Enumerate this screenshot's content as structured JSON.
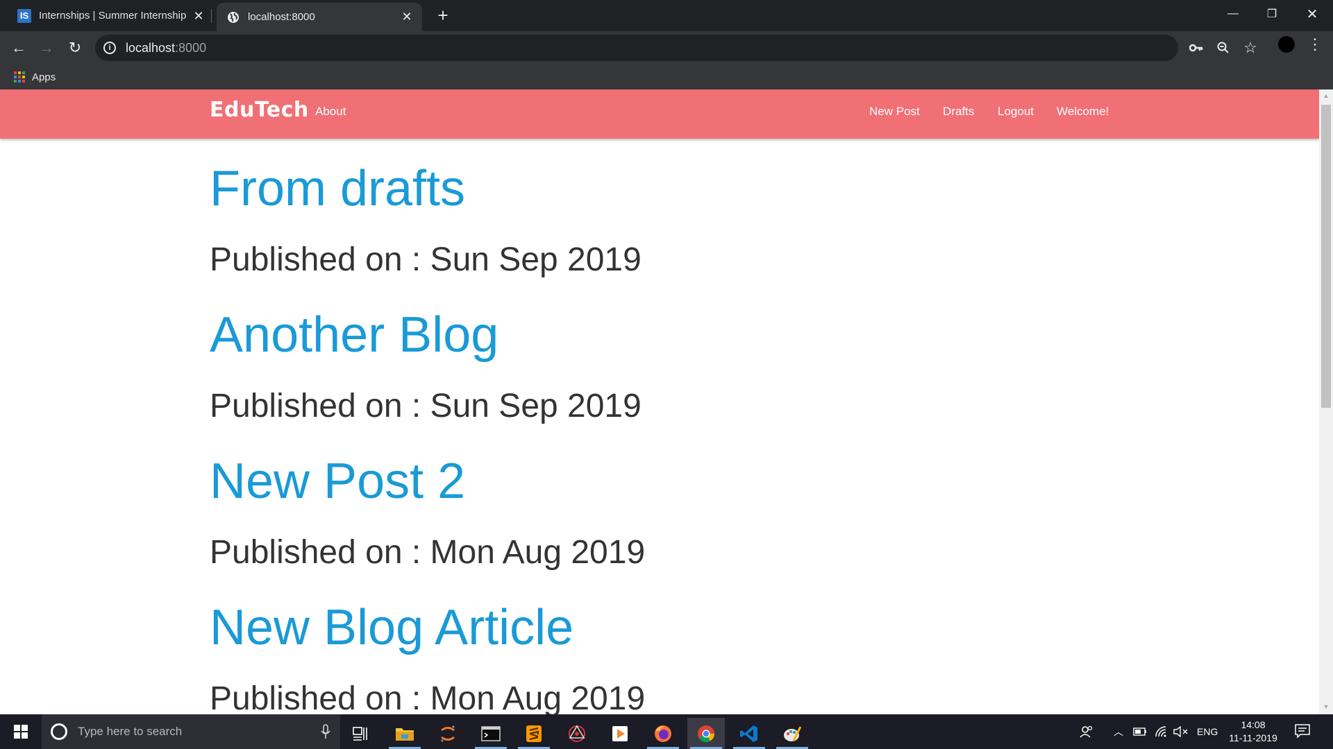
{
  "browser": {
    "tabs": [
      {
        "title": "Internships | Summer Internship |",
        "favicon": "IS",
        "active": false
      },
      {
        "title": "localhost:8000",
        "active": true
      }
    ],
    "url_host": "localhost",
    "url_port": ":8000",
    "bookmarks": {
      "apps_label": "Apps"
    }
  },
  "site": {
    "brand": "EduTech",
    "nav_left": [
      "About"
    ],
    "nav_right": [
      "New Post",
      "Drafts",
      "Logout",
      "Welcome!"
    ],
    "posts": [
      {
        "title": "From drafts",
        "published": "Published on : Sun Sep 2019"
      },
      {
        "title": "Another Blog",
        "published": "Published on : Sun Sep 2019"
      },
      {
        "title": "New Post 2",
        "published": "Published on : Mon Aug 2019"
      },
      {
        "title": "New Blog Article",
        "published": "Published on : Mon Aug 2019"
      }
    ]
  },
  "taskbar": {
    "search_placeholder": "Type here to search",
    "language": "ENG",
    "time": "14:08",
    "date": "11-11-2019"
  },
  "colors": {
    "navbar": "#f07075",
    "post_title": "#1a9ad6",
    "post_date": "#333333"
  }
}
